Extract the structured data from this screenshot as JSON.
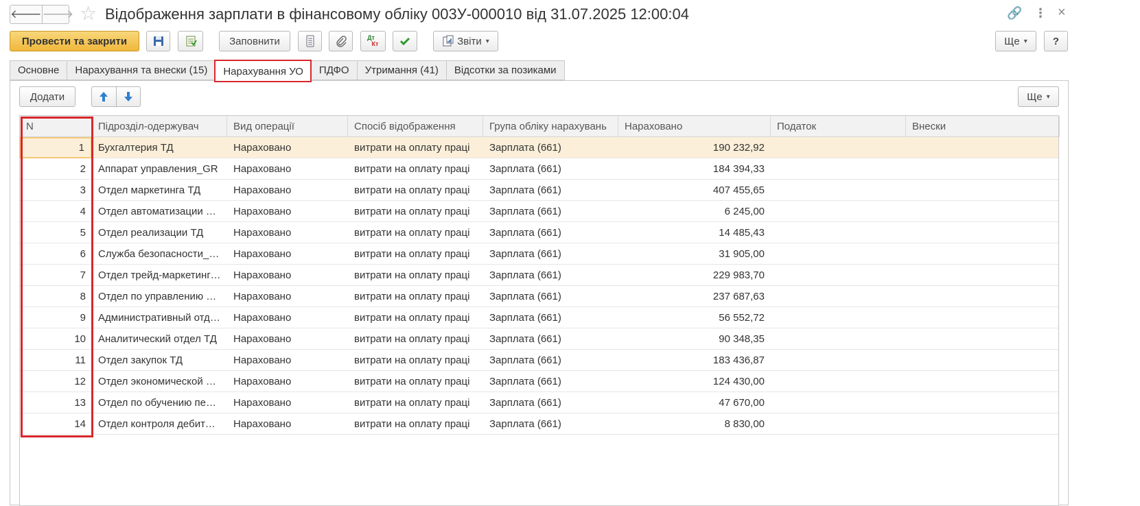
{
  "window": {
    "title": "Відображення зарплати в фінансовому обліку 003У-000010 від 31.07.2025 12:00:04",
    "controls": {
      "link": "🔗",
      "more": "⋮",
      "close": "×"
    }
  },
  "toolbar": {
    "post_close": "Провести та закрити",
    "fill": "Заповнити",
    "reports": "Звіти",
    "dtkt_top": "Дт",
    "dtkt_bottom": "Кт",
    "more": "Ще",
    "help": "?"
  },
  "tabs": [
    {
      "label": "Основне"
    },
    {
      "label": "Нарахування та внески (15)"
    },
    {
      "label": "Нарахування УО"
    },
    {
      "label": "ПДФО"
    },
    {
      "label": "Утримання (41)"
    },
    {
      "label": "Відсотки за позиками"
    }
  ],
  "active_tab": "Нарахування УО",
  "panel": {
    "add": "Додати",
    "more": "Ще"
  },
  "grid": {
    "columns": [
      "N",
      "Підрозділ-одержувач",
      "Вид операції",
      "Спосіб відображення",
      "Група обліку нарахувань",
      "Нараховано",
      "Податок",
      "Внески"
    ],
    "rows": [
      {
        "n": "1",
        "dept": "Бухгалтерия ТД",
        "op": "Нараховано",
        "method": "витрати на оплату праці",
        "group": "Зарплата (661)",
        "amount": "190 232,92",
        "tax": "",
        "contrib": ""
      },
      {
        "n": "2",
        "dept": "Аппарат управления_GR",
        "op": "Нараховано",
        "method": "витрати на оплату праці",
        "group": "Зарплата (661)",
        "amount": "184 394,33",
        "tax": "",
        "contrib": ""
      },
      {
        "n": "3",
        "dept": "Отдел маркетинга ТД",
        "op": "Нараховано",
        "method": "витрати на оплату праці",
        "group": "Зарплата (661)",
        "amount": "407 455,65",
        "tax": "",
        "contrib": ""
      },
      {
        "n": "4",
        "dept": "Отдел автоматизации учета",
        "op": "Нараховано",
        "method": "витрати на оплату праці",
        "group": "Зарплата (661)",
        "amount": "6 245,00",
        "tax": "",
        "contrib": ""
      },
      {
        "n": "5",
        "dept": "Отдел реализации ТД",
        "op": "Нараховано",
        "method": "витрати на оплату праці",
        "group": "Зарплата (661)",
        "amount": "14 485,43",
        "tax": "",
        "contrib": ""
      },
      {
        "n": "6",
        "dept": "Служба безопасности_GR",
        "op": "Нараховано",
        "method": "витрати на оплату праці",
        "group": "Зарплата (661)",
        "amount": "31 905,00",
        "tax": "",
        "contrib": ""
      },
      {
        "n": "7",
        "dept": "Отдел трейд-маркетинга ТД",
        "op": "Нараховано",
        "method": "витрати на оплату праці",
        "group": "Зарплата (661)",
        "amount": "229 983,70",
        "tax": "",
        "contrib": ""
      },
      {
        "n": "8",
        "dept": "Отдел по управлению персоналом",
        "op": "Нараховано",
        "method": "витрати на оплату праці",
        "group": "Зарплата (661)",
        "amount": "237 687,63",
        "tax": "",
        "contrib": ""
      },
      {
        "n": "9",
        "dept": "Административный отдел ТД",
        "op": "Нараховано",
        "method": "витрати на оплату праці",
        "group": "Зарплата (661)",
        "amount": "56 552,72",
        "tax": "",
        "contrib": ""
      },
      {
        "n": "10",
        "dept": "Аналитический отдел ТД",
        "op": "Нараховано",
        "method": "витрати на оплату праці",
        "group": "Зарплата (661)",
        "amount": "90 348,35",
        "tax": "",
        "contrib": ""
      },
      {
        "n": "11",
        "dept": "Отдел закупок ТД",
        "op": "Нараховано",
        "method": "витрати на оплату праці",
        "group": "Зарплата (661)",
        "amount": "183 436,87",
        "tax": "",
        "contrib": ""
      },
      {
        "n": "12",
        "dept": "Отдел экономической безопасности",
        "op": "Нараховано",
        "method": "витрати на оплату праці",
        "group": "Зарплата (661)",
        "amount": "124 430,00",
        "tax": "",
        "contrib": ""
      },
      {
        "n": "13",
        "dept": "Отдел по обучению персонала",
        "op": "Нараховано",
        "method": "витрати на оплату праці",
        "group": "Зарплата (661)",
        "amount": "47 670,00",
        "tax": "",
        "contrib": ""
      },
      {
        "n": "14",
        "dept": "Отдел контроля дебиторской задолженности",
        "op": "Нараховано",
        "method": "витрати на оплату праці",
        "group": "Зарплата (661)",
        "amount": "8 830,00",
        "tax": "",
        "contrib": ""
      }
    ]
  },
  "colors": {
    "accent": "#f0b73c",
    "highlight": "#d9262b",
    "selected_row": "#fcefd9"
  }
}
